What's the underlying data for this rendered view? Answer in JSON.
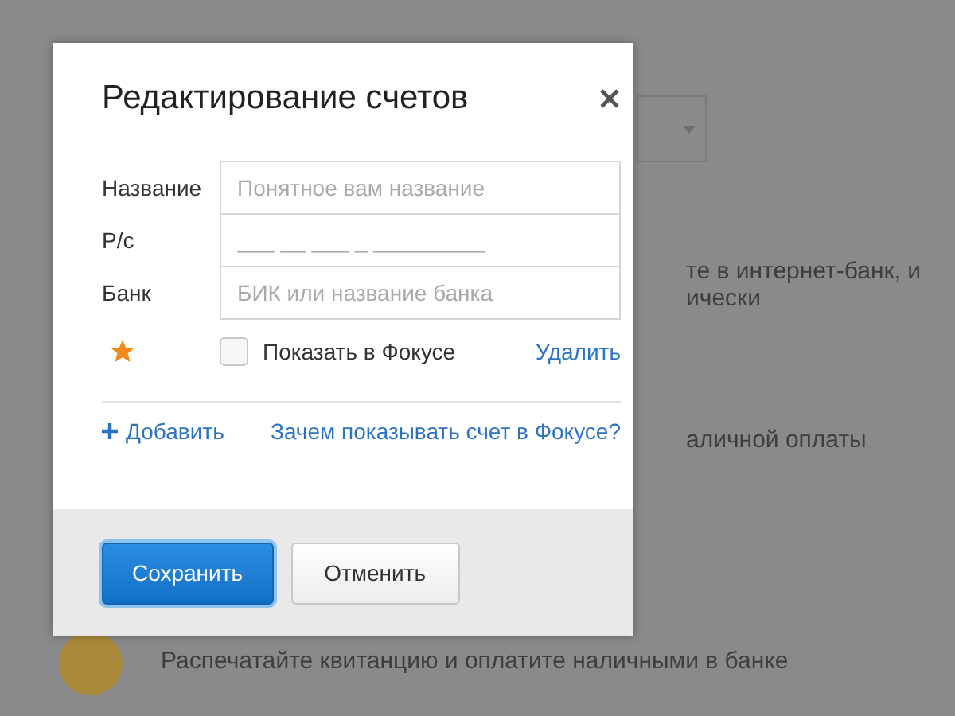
{
  "background": {
    "fragments": [
      [
        "те в интернет-банк, и",
        "ически"
      ],
      [
        "аличной оплаты"
      ]
    ],
    "payment_option": "Распечатайте квитанцию и оплатите наличными в банке"
  },
  "dialog": {
    "title": "Редактирование счетов",
    "fields": [
      {
        "label": "Название",
        "placeholder": "Понятное вам название"
      },
      {
        "label": "Р/с",
        "placeholder": "___ __ ___ _ _________"
      },
      {
        "label": "Банк",
        "placeholder": "БИК или название банка"
      }
    ],
    "account": {
      "starred": true,
      "show_in_focus": {
        "label": "Показать в Фокусе",
        "checked": false
      },
      "delete_link": "Удалить"
    },
    "add_link": "Добавить",
    "help_link": "Зачем показывать счет в Фокусе?",
    "buttons": [
      {
        "label": "Сохранить",
        "kind": "primary"
      },
      {
        "label": "Отменить",
        "kind": "secondary"
      }
    ]
  }
}
